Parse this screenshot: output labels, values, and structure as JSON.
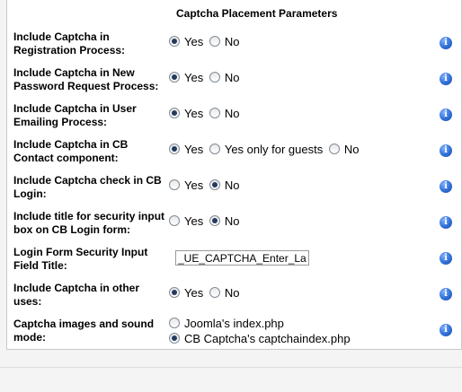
{
  "header": {
    "title": "Captcha Placement Parameters"
  },
  "rows": [
    {
      "label": "Include Captcha in Registration Process:",
      "options": [
        "Yes",
        "No"
      ],
      "selected": "Yes"
    },
    {
      "label": "Include Captcha in New Password Request Process:",
      "options": [
        "Yes",
        "No"
      ],
      "selected": "Yes"
    },
    {
      "label": "Include Captcha in User Emailing Process:",
      "options": [
        "Yes",
        "No"
      ],
      "selected": "Yes"
    },
    {
      "label": "Include Captcha in CB Contact component:",
      "options": [
        "Yes",
        "Yes only for guests",
        "No"
      ],
      "selected": "Yes"
    },
    {
      "label": "Include Captcha check in CB Login:",
      "options": [
        "Yes",
        "No"
      ],
      "selected": "No"
    },
    {
      "label": "Include title for security input box on CB Login form:",
      "options": [
        "Yes",
        "No"
      ],
      "selected": "No"
    },
    {
      "label": "Login Form Security Input Field Title:",
      "input_value": "_UE_CAPTCHA_Enter_Label"
    },
    {
      "label": "Include Captcha in other uses:",
      "options": [
        "Yes",
        "No"
      ],
      "selected": "Yes"
    },
    {
      "label": "Captcha images and sound mode:",
      "options": [
        "Joomla's index.php",
        "CB Captcha's captchaindex.php"
      ],
      "selected": "CB Captcha's captchaindex.php"
    }
  ],
  "info_icon": {
    "glyph": "i",
    "name": "info-icon"
  }
}
